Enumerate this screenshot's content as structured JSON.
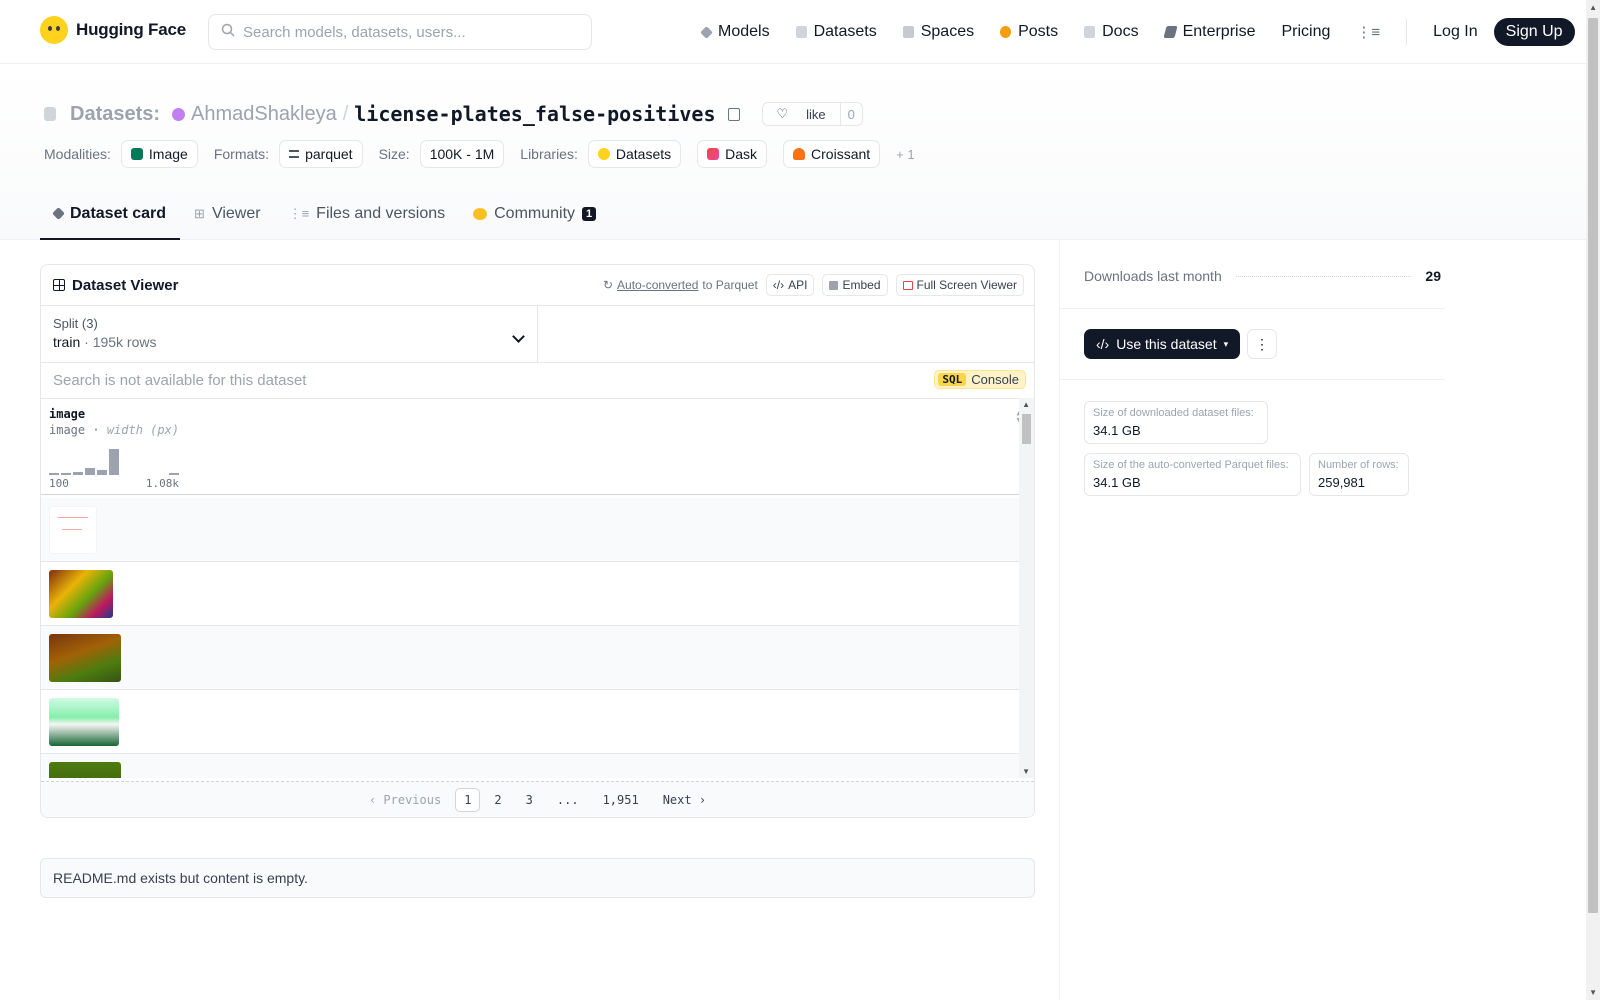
{
  "topnav": {
    "brand": "Hugging Face",
    "search_placeholder": "Search models, datasets, users...",
    "links": [
      "Models",
      "Datasets",
      "Spaces",
      "Posts",
      "Docs",
      "Enterprise",
      "Pricing"
    ],
    "login": "Log In",
    "signup": "Sign Up"
  },
  "header": {
    "section": "Datasets:",
    "owner": "AhmadShakleya",
    "slash": "/",
    "repo": "license-plates_false-positives",
    "like_label": "like",
    "like_count": "0",
    "modalities_label": "Modalities:",
    "modality": "Image",
    "formats_label": "Formats:",
    "format": "parquet",
    "size_label": "Size:",
    "size": "100K - 1M",
    "libraries_label": "Libraries:",
    "libraries": [
      "Datasets",
      "Dask",
      "Croissant"
    ],
    "more_libraries": "+ 1"
  },
  "tabs": [
    {
      "label": "Dataset card",
      "active": true
    },
    {
      "label": "Viewer"
    },
    {
      "label": "Files and versions"
    },
    {
      "label": "Community",
      "badge": "1"
    }
  ],
  "viewer": {
    "title": "Dataset Viewer",
    "auto_converted": "Auto-converted",
    "to_parquet": "to Parquet",
    "api": "API",
    "embed": "Embed",
    "fullscreen": "Full Screen Viewer",
    "split_label": "Split (3)",
    "split_name": "train",
    "split_sep": "·",
    "split_rows": "195k rows",
    "search_msg": "Search is not available for this dataset",
    "sql_tag": "SQL",
    "sql_label": "Console",
    "column_name": "image",
    "column_type": "image",
    "column_sep": "·",
    "column_stat": "width (px)",
    "hist_min": "100",
    "hist_max": "1.08k",
    "histogram": [
      0.05,
      0.05,
      0.1,
      0.25,
      0.2,
      1.0,
      0,
      0,
      0,
      0,
      0.05
    ],
    "pager": {
      "prev": "Previous",
      "pages": [
        "1",
        "2",
        "3",
        "...",
        "1,951"
      ],
      "next": "Next"
    }
  },
  "readme": "README.md exists but content is empty.",
  "sidebar": {
    "downloads_label": "Downloads last month",
    "downloads": "29",
    "use_dataset": "Use this dataset",
    "stats": [
      {
        "label": "Size of downloaded dataset files:",
        "value": "34.1 GB"
      },
      {
        "label": "Size of the auto-converted Parquet files:",
        "value": "34.1 GB"
      },
      {
        "label": "Number of rows:",
        "value": "259,981"
      }
    ]
  },
  "colors": {
    "accent": "#111827",
    "brand_yellow": "#ffd21e",
    "owner_avatar": "#c27ff3"
  }
}
